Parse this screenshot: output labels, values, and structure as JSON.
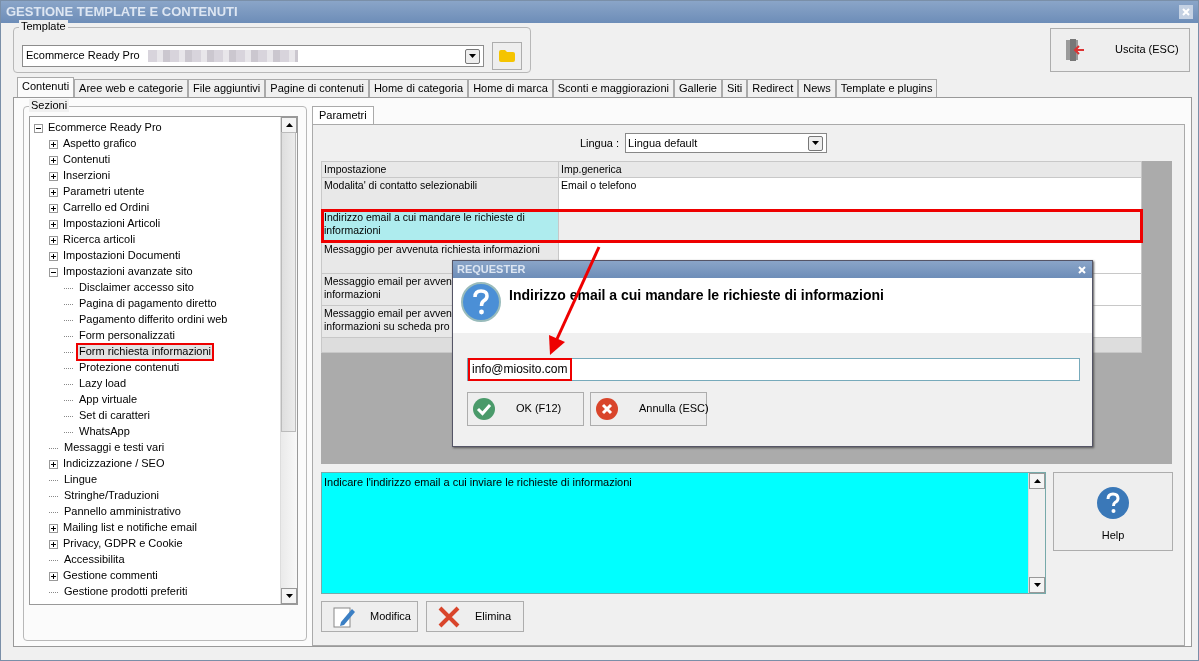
{
  "window": {
    "title": "GESTIONE TEMPLATE E CONTENUTI"
  },
  "template": {
    "label": "Template",
    "value": "Ecommerce Ready Pro"
  },
  "exit_button": "Uscita (ESC)",
  "tabs": [
    {
      "label": "Contenuti",
      "selected": true
    },
    {
      "label": "Aree web e categorie",
      "selected": false
    },
    {
      "label": "File aggiuntivi",
      "selected": false
    },
    {
      "label": "Pagine di contenuti",
      "selected": false
    },
    {
      "label": "Home di categoria",
      "selected": false
    },
    {
      "label": "Home di marca",
      "selected": false
    },
    {
      "label": "Sconti e maggiorazioni",
      "selected": false
    },
    {
      "label": "Gallerie",
      "selected": false
    },
    {
      "label": "Siti",
      "selected": false
    },
    {
      "label": "Redirect",
      "selected": false
    },
    {
      "label": "News",
      "selected": false
    },
    {
      "label": "Template e plugins",
      "selected": false
    }
  ],
  "sections": {
    "label": "Sezioni",
    "tree": [
      {
        "label": "Ecommerce Ready Pro",
        "expanded": true,
        "selected": false,
        "highlighted": false,
        "children": [
          {
            "label": "Aspetto grafico",
            "expanded": false,
            "selected": false,
            "highlighted": false
          },
          {
            "label": "Contenuti",
            "expanded": false,
            "selected": false,
            "highlighted": false
          },
          {
            "label": "Inserzioni",
            "expanded": false,
            "selected": false,
            "highlighted": false
          },
          {
            "label": "Parametri utente",
            "expanded": false,
            "selected": false,
            "highlighted": false
          },
          {
            "label": "Carrello ed Ordini",
            "expanded": false,
            "selected": false,
            "highlighted": false
          },
          {
            "label": "Impostazioni Articoli",
            "expanded": false,
            "selected": false,
            "highlighted": false
          },
          {
            "label": "Ricerca articoli",
            "expanded": false,
            "selected": false,
            "highlighted": false
          },
          {
            "label": "Impostazioni Documenti",
            "expanded": false,
            "selected": false,
            "highlighted": false
          },
          {
            "label": "Impostazioni avanzate sito",
            "expanded": true,
            "selected": false,
            "highlighted": false,
            "children": [
              {
                "label": "Disclaimer accesso sito",
                "selected": false,
                "highlighted": false
              },
              {
                "label": "Pagina di pagamento diretto",
                "selected": false,
                "highlighted": false
              },
              {
                "label": "Pagamento differito ordini web",
                "selected": false,
                "highlighted": false
              },
              {
                "label": "Form personalizzati",
                "selected": false,
                "highlighted": false
              },
              {
                "label": "Form richiesta informazioni",
                "selected": true,
                "highlighted": true
              },
              {
                "label": "Protezione contenuti",
                "selected": false,
                "highlighted": false
              },
              {
                "label": "Lazy load",
                "selected": false,
                "highlighted": false
              },
              {
                "label": "App virtuale",
                "selected": false,
                "highlighted": false
              },
              {
                "label": "Set di caratteri",
                "selected": false,
                "highlighted": false
              },
              {
                "label": "WhatsApp",
                "selected": false,
                "highlighted": false
              }
            ]
          },
          {
            "label": "Messaggi e testi vari",
            "selected": false,
            "highlighted": false
          },
          {
            "label": "Indicizzazione / SEO",
            "expanded": false,
            "selected": false,
            "highlighted": false
          },
          {
            "label": "Lingue",
            "selected": false,
            "highlighted": false
          },
          {
            "label": "Stringhe/Traduzioni",
            "selected": false,
            "highlighted": false
          },
          {
            "label": "Pannello amministrativo",
            "selected": false,
            "highlighted": false
          },
          {
            "label": "Mailing list e notifiche email",
            "expanded": false,
            "selected": false,
            "highlighted": false
          },
          {
            "label": "Privacy, GDPR e Cookie",
            "expanded": false,
            "selected": false,
            "highlighted": false
          },
          {
            "label": "Accessibilita",
            "selected": false,
            "highlighted": false
          },
          {
            "label": "Gestione commenti",
            "expanded": false,
            "selected": false,
            "highlighted": false
          },
          {
            "label": "Gestione prodotti preferiti",
            "selected": false,
            "highlighted": false
          }
        ]
      }
    ]
  },
  "subtabs": [
    {
      "label": "Parametri",
      "selected": true
    }
  ],
  "language": {
    "label": "Lingua :",
    "value": "Lingua default"
  },
  "table": {
    "columns": [
      "Impostazione",
      "Imp.generica"
    ],
    "rows": [
      {
        "cells": [
          "Modalita' di contatto selezionabili",
          "Email o telefono"
        ],
        "selected": false,
        "highlighted": false
      },
      {
        "cells": [
          "Indirizzo email a cui mandare le richieste di informazioni",
          ""
        ],
        "selected": true,
        "highlighted": true
      },
      {
        "cells": [
          "Messaggio per avvenuta richiesta informazioni",
          ""
        ],
        "selected": false,
        "highlighted": false
      },
      {
        "cells": [
          "Messaggio email per avven\ninformazioni",
          ""
        ],
        "selected": false,
        "highlighted": false
      },
      {
        "cells": [
          "Messaggio email per avven\ninformazioni su scheda pro",
          ""
        ],
        "selected": false,
        "highlighted": false
      }
    ]
  },
  "description": "Indicare l'indirizzo email a cui inviare le richieste di informazioni",
  "help_button": "Help",
  "actions": [
    {
      "kind": "edit",
      "label": "Modifica"
    },
    {
      "kind": "delete",
      "label": "Elimina"
    }
  ],
  "dialog": {
    "title": "REQUESTER",
    "message": "Indirizzo email a cui mandare le richieste di informazioni",
    "value": "info@miosito.com",
    "value_highlighted": true,
    "buttons": [
      {
        "kind": "ok",
        "label": "OK (F12)"
      },
      {
        "kind": "cancel",
        "label": "Annulla (ESC)"
      }
    ]
  }
}
